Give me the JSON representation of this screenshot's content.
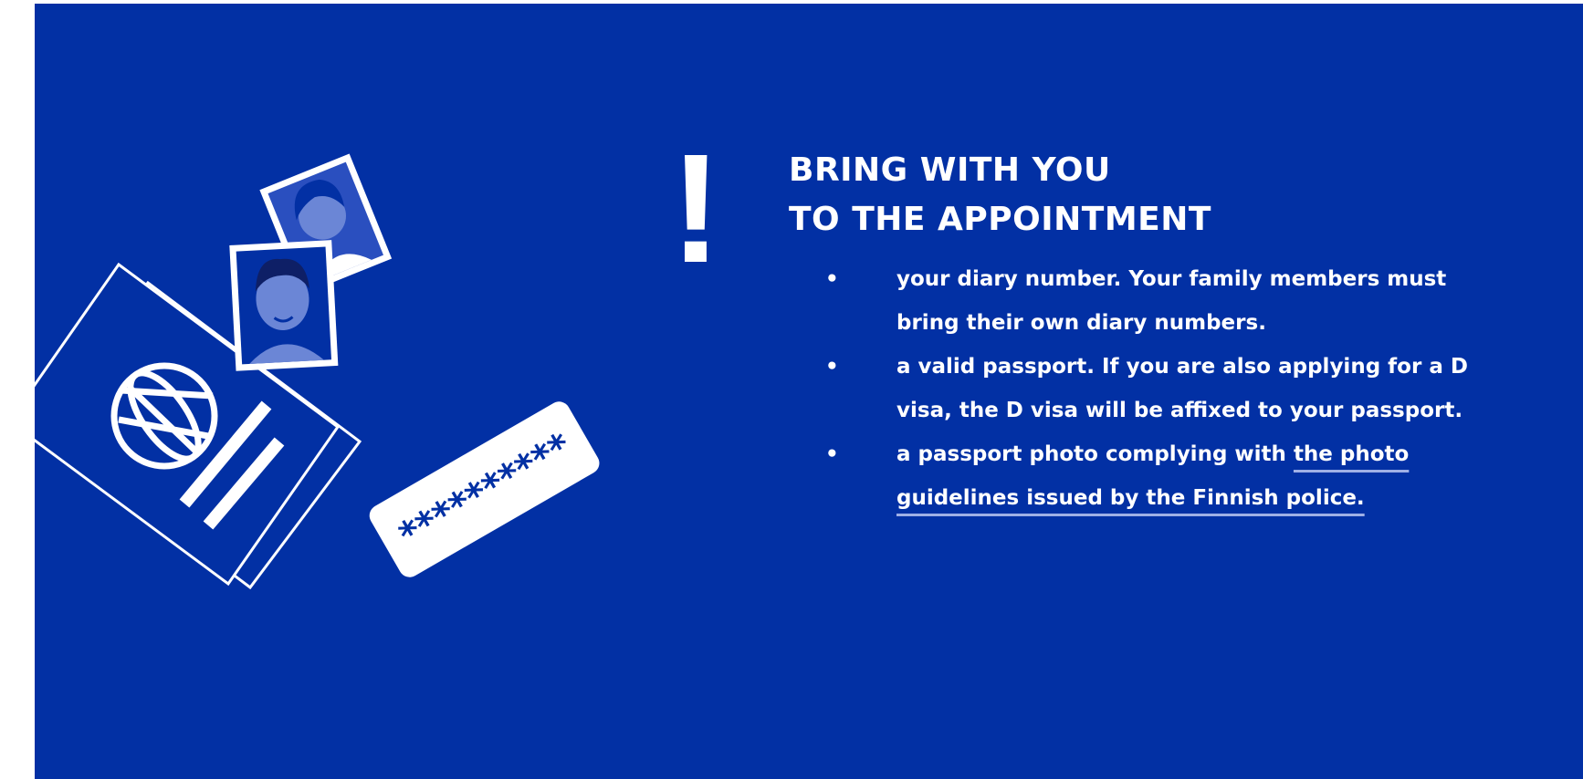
{
  "notice": {
    "symbol": "!",
    "title_lines": [
      "BRING WITH YOU",
      "TO THE APPOINTMENT"
    ],
    "items": [
      {
        "text": "your diary number. Your family members must bring their own diary numbers."
      },
      {
        "text": "a valid passport. If you are also applying for a D visa, the D visa will be affixed to your passport."
      },
      {
        "text": "a passport photo complying with ",
        "link": "the photo guidelines issued by the Finnish police."
      }
    ]
  },
  "illustration": {
    "diary_number_card": "**********",
    "icons": [
      "passport-icon",
      "globe-icon",
      "person-photo-icon",
      "diary-number-card-icon"
    ]
  },
  "colors": {
    "background": "#0230a4",
    "foreground": "#ffffff",
    "link_underline": "#9fb0e6",
    "accent_blue": "#2a4fbf"
  }
}
